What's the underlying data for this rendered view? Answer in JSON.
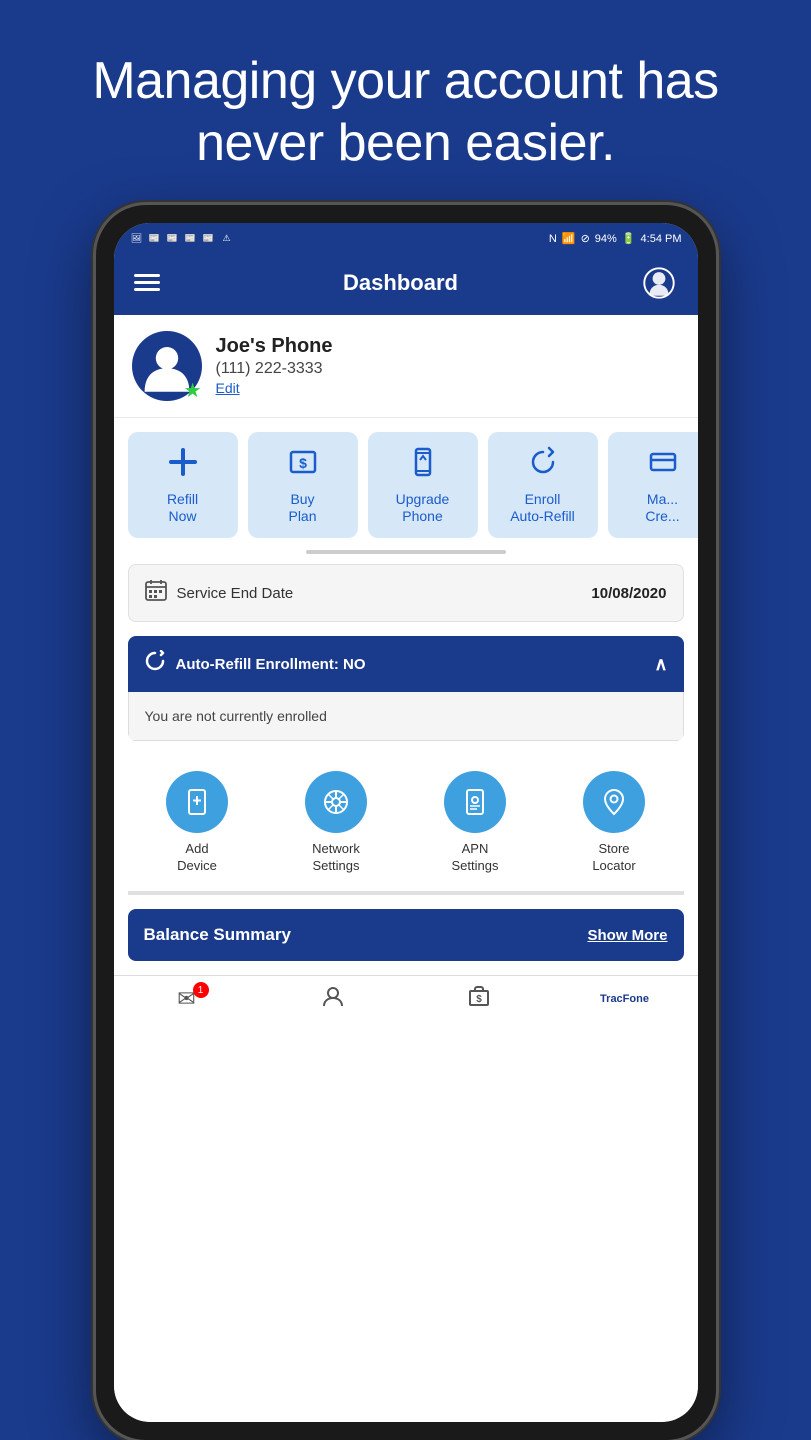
{
  "hero": {
    "title": "Managing your account has never been easier."
  },
  "statusBar": {
    "time": "4:54 PM",
    "battery": "94%",
    "icons": [
      "img",
      "news",
      "news",
      "news",
      "news",
      "warning",
      "nfc",
      "wifi",
      "dnd"
    ]
  },
  "appBar": {
    "title": "Dashboard",
    "menuLabel": "Menu",
    "supportLabel": "Support"
  },
  "profile": {
    "name": "Joe's Phone",
    "phone": "(111) 222-3333",
    "editLabel": "Edit"
  },
  "actions": [
    {
      "id": "refill",
      "label": "Refill\nNow",
      "icon": "+"
    },
    {
      "id": "buy-plan",
      "label": "Buy Plan",
      "icon": "$"
    },
    {
      "id": "upgrade-phone",
      "label": "Upgrade Phone",
      "icon": "📱"
    },
    {
      "id": "enroll-auto-refill",
      "label": "Enroll Auto-Refill",
      "icon": "↻"
    },
    {
      "id": "manage-credit",
      "label": "Ma... Cre...",
      "icon": "≡"
    }
  ],
  "serviceEndDate": {
    "label": "Service End Date",
    "date": "10/08/2020"
  },
  "autoRefill": {
    "label": "Auto-Refill Enrollment: NO",
    "body": "You are not currently enrolled"
  },
  "secondaryActions": [
    {
      "id": "add-device",
      "label": "Add\nDevice"
    },
    {
      "id": "network-settings",
      "label": "Network\nSettings"
    },
    {
      "id": "apn-settings",
      "label": "APN\nSettings"
    },
    {
      "id": "store-locator",
      "label": "Store\nLocator"
    }
  ],
  "balanceSummary": {
    "title": "Balance Summary",
    "showMoreLabel": "Show More"
  },
  "bottomNav": [
    {
      "id": "mail",
      "badge": "1"
    },
    {
      "id": "account"
    },
    {
      "id": "refill"
    },
    {
      "id": "tracfone",
      "isLogo": true
    }
  ]
}
